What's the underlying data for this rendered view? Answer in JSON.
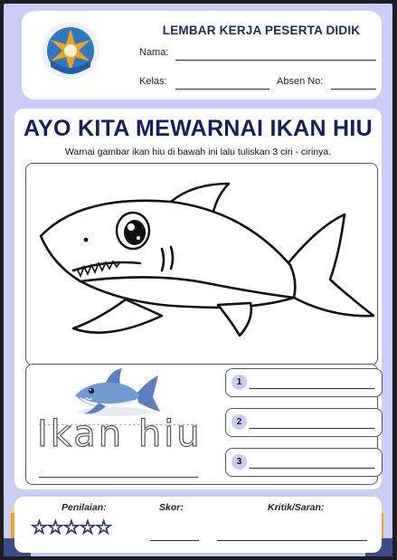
{
  "header": {
    "title": "LEMBAR KERJA PESERTA DIDIK",
    "nama_label": "Nama:",
    "kelas_label": "Kelas:",
    "absen_label": "Absen No:"
  },
  "worksheet": {
    "title": "AYO KITA MEWARNAI IKAN HIU",
    "instruction": "Warnai gambar ikan hiu di bawah ini lalu tuliskan 3 ciri - cirinya.",
    "trace_word": "Ikan hiu",
    "answers": [
      {
        "number": "1"
      },
      {
        "number": "2"
      },
      {
        "number": "3"
      }
    ]
  },
  "footer": {
    "penilaian_label": "Penilaian:",
    "skor_label": "Skor:",
    "kritik_label": "Kritik/Saran:",
    "star_count": 5
  },
  "colors": {
    "background": "#c9cdf6",
    "title_navy": "#14205c",
    "border_blue": "#46559a",
    "logo_orange": "#f3a21c",
    "logo_blue": "#2f78c4",
    "shark_blue": "#6c8fc7"
  }
}
